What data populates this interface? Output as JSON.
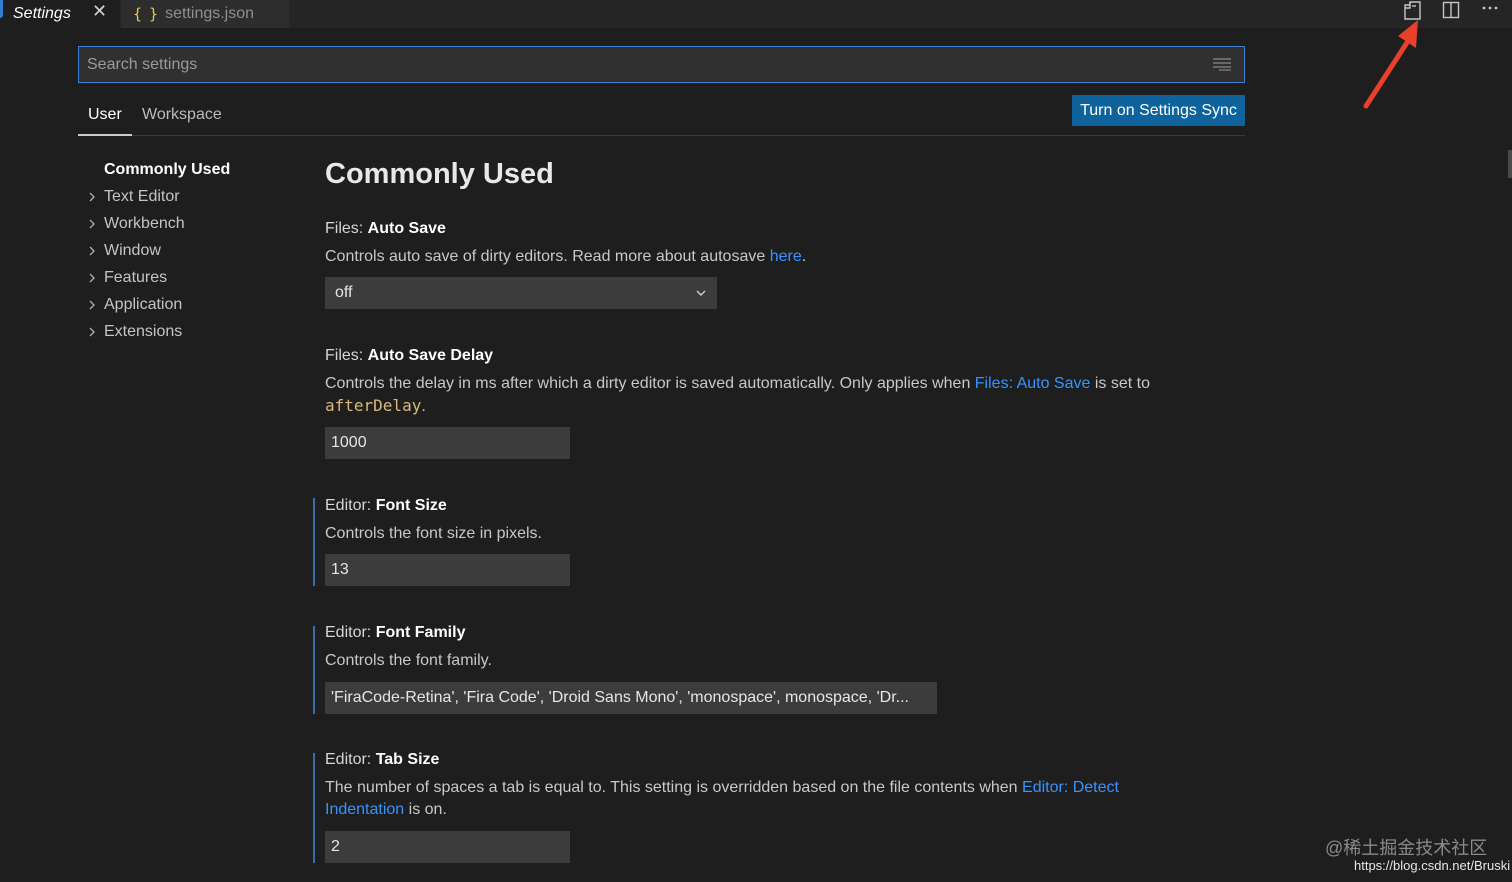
{
  "tabs": [
    {
      "label": "Settings",
      "close": "✕"
    },
    {
      "icon": "{ }",
      "label": "settings.json"
    }
  ],
  "search": {
    "placeholder": "Search settings"
  },
  "scope_tabs": {
    "user": "User",
    "workspace": "Workspace"
  },
  "sync_button": "Turn on Settings Sync",
  "toc": [
    "Commonly Used",
    "Text Editor",
    "Workbench",
    "Window",
    "Features",
    "Application",
    "Extensions"
  ],
  "page_title": "Commonly Used",
  "settings": {
    "auto_save": {
      "category": "Files: ",
      "key": "Auto Save",
      "desc_before": "Controls auto save of dirty editors. Read more about autosave ",
      "desc_link": "here",
      "desc_after": ".",
      "value": "off"
    },
    "auto_save_delay": {
      "category": "Files: ",
      "key": "Auto Save Delay",
      "desc_before": "Controls the delay in ms after which a dirty editor is saved automatically. Only applies when ",
      "desc_link": "Files: Auto Save",
      "desc_mid": " is set to",
      "desc_code": "afterDelay",
      "desc_after": ".",
      "value": "1000"
    },
    "font_size": {
      "category": "Editor: ",
      "key": "Font Size",
      "desc": "Controls the font size in pixels.",
      "value": "13"
    },
    "font_family": {
      "category": "Editor: ",
      "key": "Font Family",
      "desc": "Controls the font family.",
      "value": "'FiraCode-Retina', 'Fira Code', 'Droid Sans Mono', 'monospace', monospace, 'Dr..."
    },
    "tab_size": {
      "category": "Editor: ",
      "key": "Tab Size",
      "desc_before": "The number of spaces a tab is equal to. This setting is overridden based on the file contents when ",
      "desc_link1": "Editor: Detect",
      "desc_link2": "Indentation",
      "desc_after": " is on.",
      "value": "2"
    }
  },
  "watermark": {
    "text": "@稀土掘金技术社区",
    "url": "https://blog.csdn.net/Bruski"
  },
  "colors": {
    "accent": "#0e639c",
    "link": "#3794ff",
    "focus_border": "#3b7fd6",
    "annotation_arrow": "#e8402a",
    "code": "#d7ba7d"
  }
}
